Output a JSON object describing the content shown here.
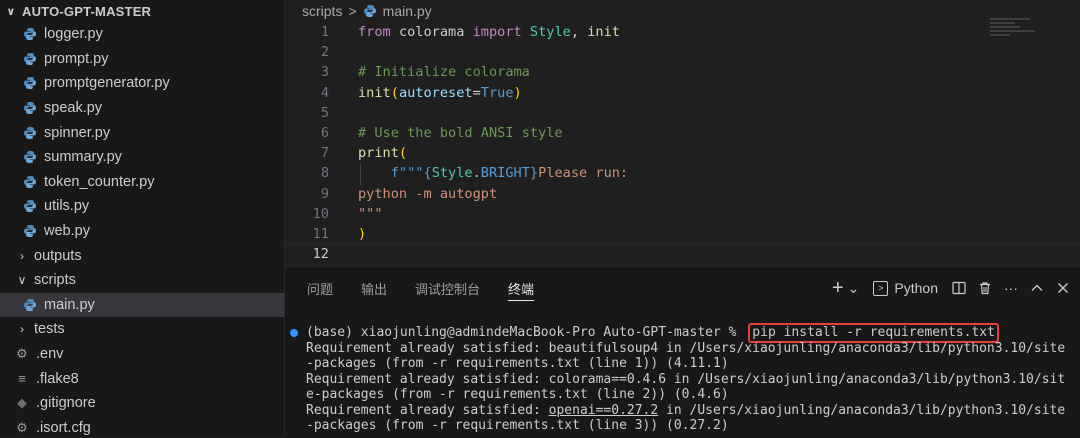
{
  "sidebar": {
    "title": "AUTO-GPT-MASTER",
    "files": [
      {
        "name": "logger.py"
      },
      {
        "name": "prompt.py"
      },
      {
        "name": "promptgenerator.py"
      },
      {
        "name": "speak.py"
      },
      {
        "name": "spinner.py"
      },
      {
        "name": "summary.py"
      },
      {
        "name": "token_counter.py"
      },
      {
        "name": "utils.py"
      },
      {
        "name": "web.py"
      }
    ],
    "folders": {
      "outputs": "outputs",
      "scripts": "scripts",
      "main": "main.py",
      "tests": "tests"
    },
    "root_files": {
      "env": ".env",
      "flake8": ".flake8",
      "gitignore": ".gitignore",
      "isort": ".isort.cfg"
    }
  },
  "editor": {
    "breadcrumb": {
      "folder": "scripts",
      "file": "main.py",
      "separator": ">"
    },
    "line_numbers": [
      "1",
      "2",
      "3",
      "4",
      "5",
      "6",
      "7",
      "8",
      "9",
      "10",
      "11",
      "12"
    ],
    "code": {
      "l1": {
        "from": "from",
        "mod": "colorama",
        "imp": "import",
        "cls": "Style",
        "comma": ",",
        "fn": "init"
      },
      "l3": "# Initialize colorama",
      "l4": {
        "fn": "init",
        "open": "(",
        "arg": "autoreset",
        "eq": "=",
        "val": "True",
        "close": ")"
      },
      "l6": "# Use the bold ANSI style",
      "l7": {
        "fn": "print",
        "open": "("
      },
      "l8": {
        "prefix": "f\"\"\"",
        "lb": "{",
        "cls": "Style",
        "dot": ".",
        "attr": "BRIGHT",
        "rb": "}",
        "text": "Please run:"
      },
      "l9": "python -m autogpt",
      "l10": "\"\"\"",
      "l11": ")"
    }
  },
  "panel": {
    "tabs": [
      "问题",
      "输出",
      "调试控制台",
      "终端"
    ],
    "active_tab": "终端",
    "actions": {
      "add": "+",
      "dropdown": "⌄",
      "shell": "Python",
      "more": "···"
    },
    "terminal": {
      "prompt": "(base) xiaojunling@admindeMacBook-Pro Auto-GPT-master % ",
      "command": "pip install -r requirements.txt",
      "lines": [
        "Requirement already satisfied: beautifulsoup4 in /Users/xiaojunling/anaconda3/lib/python3.10/site",
        "-packages (from -r requirements.txt (line 1)) (4.11.1)",
        "Requirement already satisfied: colorama==0.4.6 in /Users/xiaojunling/anaconda3/lib/python3.10/sit",
        "e-packages (from -r requirements.txt (line 2)) (0.4.6)"
      ],
      "line_openai": {
        "pre": "Requirement already satisfied: ",
        "pkg": "openai==0.27.2",
        "post": " in /Users/xiaojunling/anaconda3/lib/python3.10/site"
      },
      "last_line": "-packages (from -r requirements.txt (line 3)) (0.27.2)"
    }
  },
  "colors": {
    "accent": "#3794ff",
    "highlight_box": "#e5413a",
    "python_icon": "#4b8bbe"
  }
}
